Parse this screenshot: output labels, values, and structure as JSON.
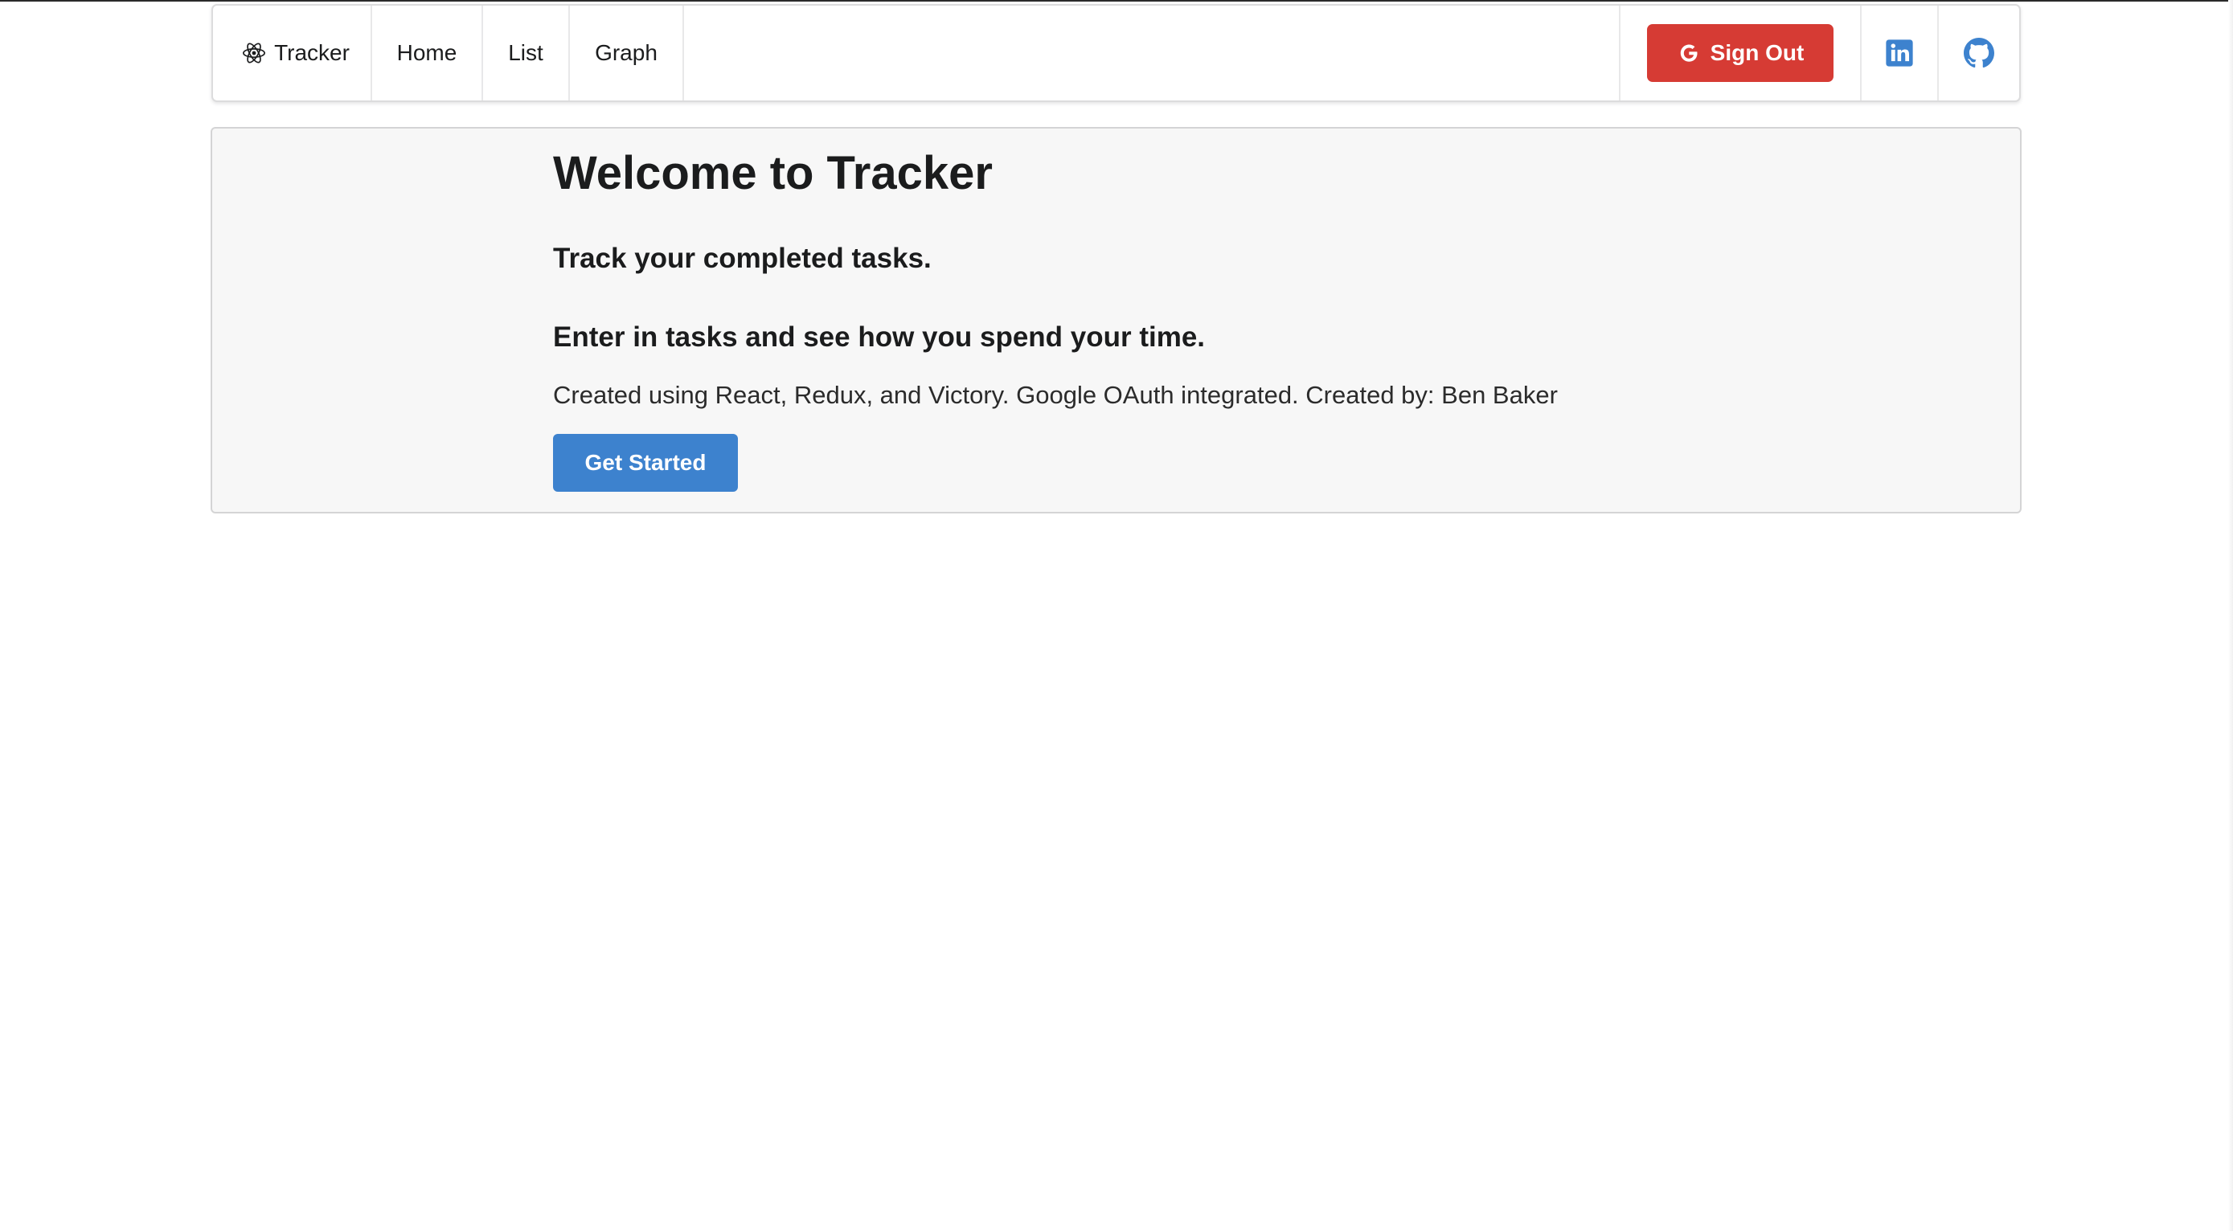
{
  "nav": {
    "brand_label": "Tracker",
    "brand_icon": "react-atom-icon",
    "items": [
      {
        "label": "Home"
      },
      {
        "label": "List"
      },
      {
        "label": "Graph"
      }
    ],
    "signout_label": "Sign Out",
    "signout_icon": "google-icon",
    "social_icons": [
      "linkedin-icon",
      "github-icon"
    ]
  },
  "hero": {
    "title": "Welcome to Tracker",
    "subtitle1": "Track your completed tasks.",
    "subtitle2": "Enter in tasks and see how you spend your time.",
    "description": "Created using React, Redux, and Victory. Google OAuth integrated. Created by: Ben Baker",
    "cta_label": "Get Started"
  },
  "colors": {
    "signout": "#d63b34",
    "primary": "#3d82ce",
    "icon_blue": "#3d82ce",
    "hero_bg": "#f7f7f7"
  }
}
